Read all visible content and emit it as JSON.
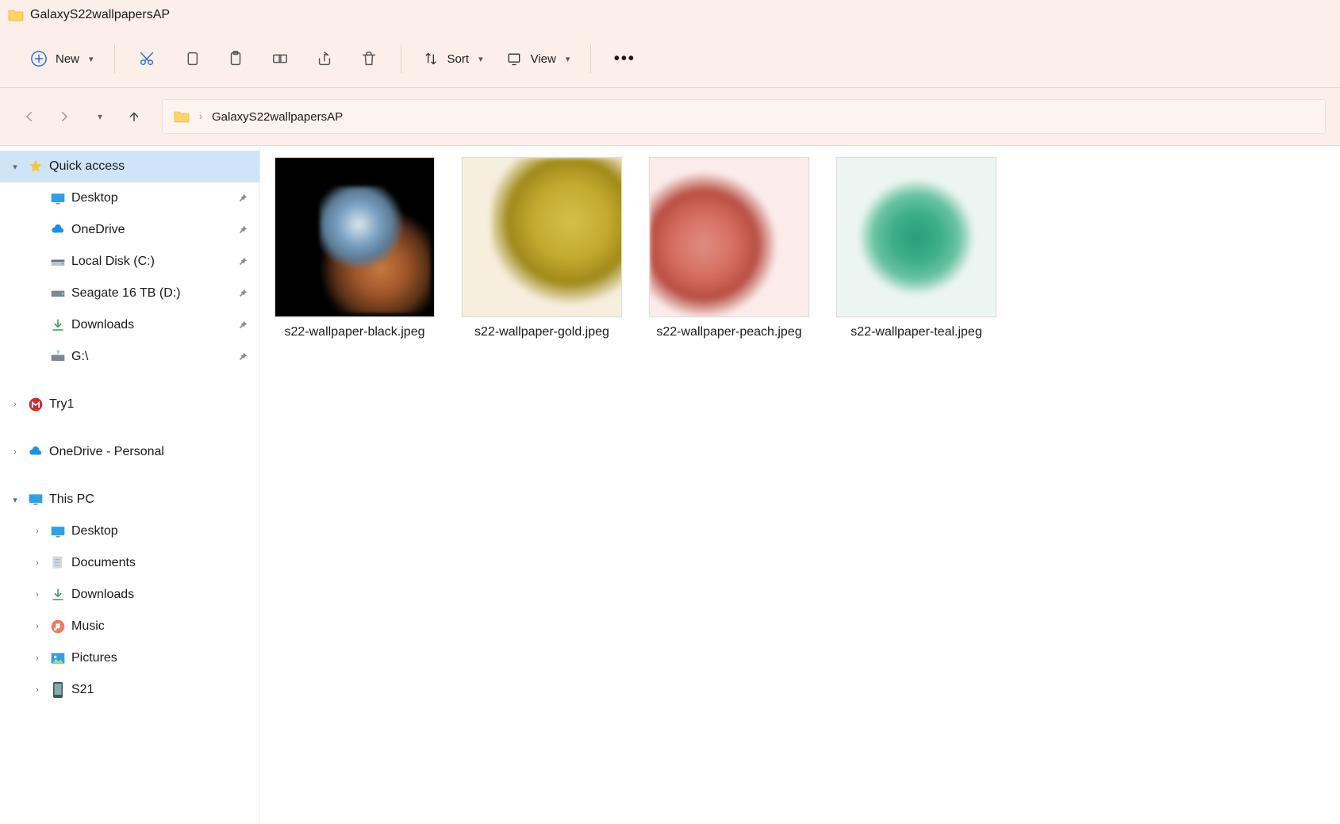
{
  "window": {
    "title": "GalaxyS22wallpapersAP"
  },
  "toolbar": {
    "new_label": "New",
    "sort_label": "Sort",
    "view_label": "View"
  },
  "breadcrumb": {
    "current": "GalaxyS22wallpapersAP"
  },
  "sidebar": {
    "quick_access": "Quick access",
    "pinned": [
      {
        "label": "Desktop",
        "icon": "desktop"
      },
      {
        "label": "OneDrive",
        "icon": "onedrive"
      },
      {
        "label": "Local Disk (C:)",
        "icon": "disk"
      },
      {
        "label": "Seagate 16 TB (D:)",
        "icon": "drive"
      },
      {
        "label": "Downloads",
        "icon": "download"
      },
      {
        "label": "G:\\",
        "icon": "drive-q"
      }
    ],
    "try1": "Try1",
    "onedrive_personal": "OneDrive - Personal",
    "this_pc": "This PC",
    "pc_items": [
      {
        "label": "Desktop",
        "icon": "desktop"
      },
      {
        "label": "Documents",
        "icon": "documents"
      },
      {
        "label": "Downloads",
        "icon": "download"
      },
      {
        "label": "Music",
        "icon": "music"
      },
      {
        "label": "Pictures",
        "icon": "pictures"
      },
      {
        "label": "S21",
        "icon": "phone"
      }
    ]
  },
  "files": [
    {
      "label": "s22-wallpaper-black.jpeg",
      "variant": "black"
    },
    {
      "label": "s22-wallpaper-gold.jpeg",
      "variant": "gold"
    },
    {
      "label": "s22-wallpaper-peach.jpeg",
      "variant": "peach"
    },
    {
      "label": "s22-wallpaper-teal.jpeg",
      "variant": "teal"
    }
  ]
}
